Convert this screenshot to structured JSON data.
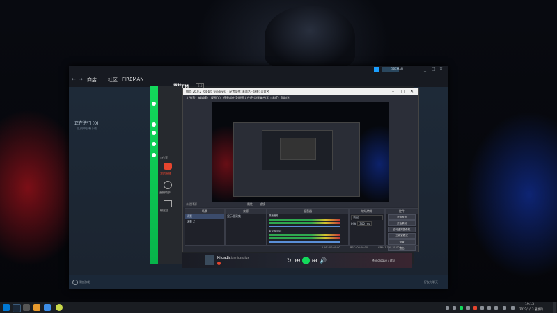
{
  "steam": {
    "nav_back": "←",
    "nav_forward": "→",
    "tab_library": "商店",
    "tab_community": "社区",
    "username": "FIREMAN",
    "downloads_title": "正在进行 (0)",
    "downloads_sub": "队列中没有下载",
    "add_game": "添加游戏",
    "friends": "好友与聊天"
  },
  "greenapp": {
    "title": "荔枝FM",
    "version": "2.0",
    "side_labels": [
      "工作室",
      "我的直播",
      "直播助手",
      "粉丝团"
    ]
  },
  "obs": {
    "title": "OBS 26.0.2 (64-bit, windows) - 配置文件: 未命名 - 场景: 未命名",
    "menu": [
      "文件(F)",
      "编辑(E)",
      "视图(V)",
      "停靠部件(D)",
      "配置文件(P)",
      "场景集合(S)",
      "工具(T)",
      "帮助(H)"
    ],
    "no_source": "未选择源",
    "btn_properties": "属性",
    "btn_filters": "滤镜",
    "scenes_header": "场景",
    "scene_items": [
      "场景",
      "场景 2"
    ],
    "sources_header": "来源",
    "source_items": [
      "显示器采集"
    ],
    "mixer_header": "混音器",
    "mixer_channels": [
      "桌面音频",
      "麦克风/Aux"
    ],
    "transitions_header": "转场特效",
    "transition_value": "淡出",
    "duration_label": "时长",
    "duration_value": "300 ms",
    "controls_header": "控件",
    "controls": [
      "开始推流",
      "开始录制",
      "启动虚拟摄像机",
      "工作室模式",
      "设置",
      "退出"
    ],
    "status": [
      "LIVE: 00:00:00",
      "REC: 00:00:00",
      "CPU: 1.1%, 30.00 fps"
    ]
  },
  "music": {
    "song": "Kiloadic",
    "artist": "Jannicanalize",
    "lyrics": "Monologue / 歌词"
  },
  "taskbar": {
    "time": "19:13",
    "date": "2022/1/13 星期四"
  },
  "colors": {
    "steam_bg": "#1b2838",
    "green_accent": "#13d95b",
    "obs_bg": "#2b2e38"
  }
}
